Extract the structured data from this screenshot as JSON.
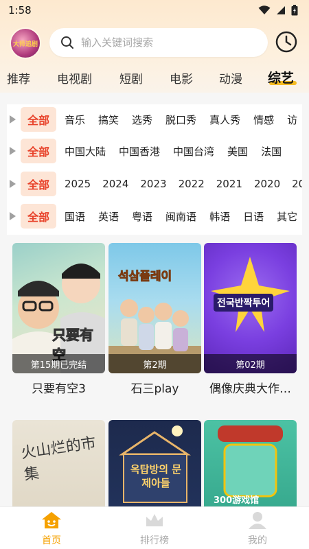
{
  "status": {
    "time": "1:58"
  },
  "header": {
    "logo_text": "大师追剧",
    "search_placeholder": "输入关键词搜索"
  },
  "tabs": [
    {
      "label": "推荐"
    },
    {
      "label": "电视剧"
    },
    {
      "label": "短剧"
    },
    {
      "label": "电影"
    },
    {
      "label": "动漫"
    },
    {
      "label": "综艺"
    }
  ],
  "filters": {
    "all_label": "全部",
    "rows": [
      {
        "items": [
          "音乐",
          "搞笑",
          "选秀",
          "脱口秀",
          "真人秀",
          "情感",
          "访"
        ]
      },
      {
        "items": [
          "中国大陆",
          "中国香港",
          "中国台湾",
          "美国",
          "法国"
        ]
      },
      {
        "items": [
          "2025",
          "2024",
          "2023",
          "2022",
          "2021",
          "2020",
          "20"
        ]
      },
      {
        "items": [
          "国语",
          "英语",
          "粤语",
          "闽南语",
          "韩语",
          "日语",
          "其它"
        ]
      }
    ]
  },
  "shows": [
    {
      "title": "只要有空3",
      "badge": "第15期已完结",
      "poster_text": "只要有空"
    },
    {
      "title": "石三play",
      "badge": "第2期",
      "poster_text": "석삼플레이"
    },
    {
      "title": "偶像庆典大作…",
      "badge": "第02期",
      "poster_text": "전국반짝투어"
    },
    {
      "title": "",
      "badge": "",
      "poster_text": "火山烂的市集"
    },
    {
      "title": "",
      "badge": "",
      "poster_text": "옥탑방의 문제아들"
    },
    {
      "title": "",
      "badge": "",
      "poster_text": "300游戏馆"
    }
  ],
  "bottom_nav": [
    {
      "label": "首页",
      "active": true
    },
    {
      "label": "排行榜",
      "active": false
    },
    {
      "label": "我的",
      "active": false
    }
  ],
  "colors": {
    "accent": "#f5a100",
    "chip_red": "#e8422a",
    "chip_bg": "#fde5d6"
  }
}
